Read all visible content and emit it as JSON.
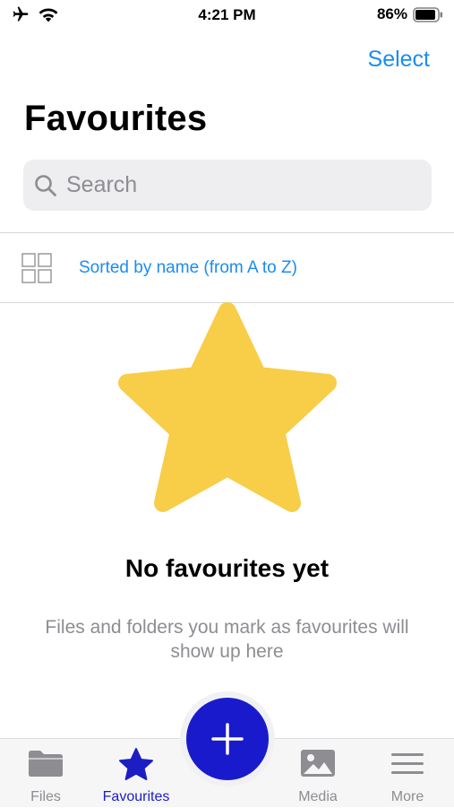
{
  "status_bar": {
    "time": "4:21 PM",
    "battery_percent": "86%",
    "icons": [
      "airplane-icon",
      "wifi-icon",
      "battery-icon"
    ]
  },
  "header": {
    "select_label": "Select",
    "title": "Favourites"
  },
  "search": {
    "placeholder": "Search",
    "value": ""
  },
  "sort": {
    "label": "Sorted by name (from A to Z)"
  },
  "empty_state": {
    "icon": "star-icon",
    "title": "No favourites yet",
    "description": "Files and folders you mark as favourites will show up here"
  },
  "tab_bar": {
    "tabs": [
      {
        "label": "Files",
        "icon": "folder-icon",
        "active": false
      },
      {
        "label": "Favourites",
        "icon": "star-icon",
        "active": true
      },
      {
        "label": "Media",
        "icon": "photo-icon",
        "active": false
      },
      {
        "label": "More",
        "icon": "menu-icon",
        "active": false
      }
    ],
    "fab_icon": "plus-icon"
  },
  "colors": {
    "accent": "#1a8cf0",
    "fab": "#1a1acd",
    "active_tab": "#1d1dc4",
    "star": "#f8cd48",
    "inactive_tab": "#8d8d92"
  }
}
